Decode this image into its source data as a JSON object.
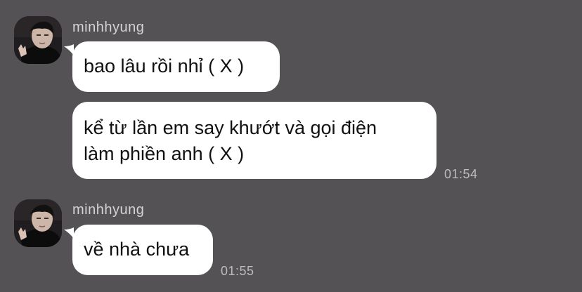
{
  "groups": [
    {
      "avatar_icon": "profile-photo-icon",
      "sender": "minhhyung",
      "messages": [
        {
          "text": "bao lâu rồi nhỉ ( X )"
        },
        {
          "lines": [
            "kể từ lần em say khướt và gọi điện",
            "làm phiền anh ( X )"
          ],
          "time": "01:54"
        }
      ]
    },
    {
      "avatar_icon": "profile-photo-icon",
      "sender": "minhhyung",
      "messages": [
        {
          "text": "về nhà chưa",
          "time": "01:55"
        }
      ]
    }
  ],
  "colors": {
    "background": "#545255",
    "bubble": "#ffffff",
    "sender_text": "#d5d3d6",
    "time_text": "#bdbbbe"
  }
}
